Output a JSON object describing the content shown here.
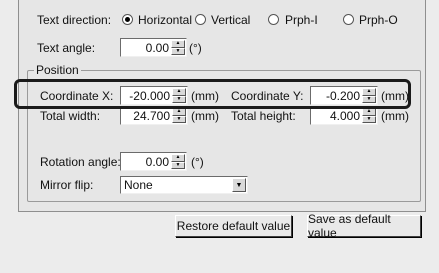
{
  "text_direction": {
    "label": "Text direction:",
    "options": [
      {
        "label": "Horizontal",
        "selected": true
      },
      {
        "label": "Vertical",
        "selected": false
      },
      {
        "label": "Prph-I",
        "selected": false
      },
      {
        "label": "Prph-O",
        "selected": false
      }
    ]
  },
  "text_angle": {
    "label": "Text angle:",
    "value": "0.00",
    "unit": "(°)"
  },
  "position": {
    "group_title": "Position",
    "coordinate_x": {
      "label": "Coordinate X:",
      "value": "-20.000",
      "unit": "(mm)"
    },
    "coordinate_y": {
      "label": "Coordinate Y:",
      "value": "-0.200",
      "unit": "(mm)"
    },
    "total_width": {
      "label": "Total width:",
      "value": "24.700",
      "unit": "(mm)"
    },
    "total_height": {
      "label": "Total height:",
      "value": "4.000",
      "unit": "(mm)"
    },
    "rotation_angle": {
      "label": "Rotation angle:",
      "value": "0.00",
      "unit": "(°)"
    },
    "mirror_flip": {
      "label": "Mirror flip:",
      "value": "None"
    }
  },
  "buttons": {
    "restore_default": "Restore default value",
    "save_default": "Save as default value"
  }
}
